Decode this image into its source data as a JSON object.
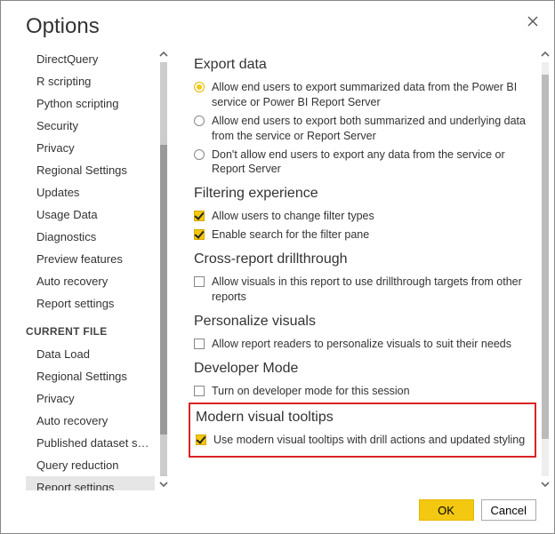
{
  "dialog": {
    "title": "Options"
  },
  "sidebar": {
    "global_items": [
      "DirectQuery",
      "R scripting",
      "Python scripting",
      "Security",
      "Privacy",
      "Regional Settings",
      "Updates",
      "Usage Data",
      "Diagnostics",
      "Preview features",
      "Auto recovery",
      "Report settings"
    ],
    "cf_heading": "CURRENT FILE",
    "cf_items": [
      "Data Load",
      "Regional Settings",
      "Privacy",
      "Auto recovery",
      "Published dataset set...",
      "Query reduction",
      "Report settings"
    ],
    "cf_selected_index": 6
  },
  "content": {
    "export": {
      "title": "Export data",
      "opt0": "Allow end users to export summarized data from the Power BI service or Power BI Report Server",
      "opt1": "Allow end users to export both summarized and underlying data from the service or Report Server",
      "opt2": "Don't allow end users to export any data from the service or Report Server",
      "selected": 0
    },
    "filtering": {
      "title": "Filtering experience",
      "chk0": {
        "label": "Allow users to change filter types",
        "checked": true
      },
      "chk1": {
        "label": "Enable search for the filter pane",
        "checked": true
      }
    },
    "crossreport": {
      "title": "Cross-report drillthrough",
      "chk0": {
        "label": "Allow visuals in this report to use drillthrough targets from other reports",
        "checked": false
      }
    },
    "personalize": {
      "title": "Personalize visuals",
      "chk0": {
        "label": "Allow report readers to personalize visuals to suit their needs",
        "checked": false
      }
    },
    "devmode": {
      "title": "Developer Mode",
      "chk0": {
        "label": "Turn on developer mode for this session",
        "checked": false
      }
    },
    "tooltips": {
      "title": "Modern visual tooltips",
      "chk0": {
        "label": "Use modern visual tooltips with drill actions and updated styling",
        "checked": true
      }
    }
  },
  "buttons": {
    "ok": "OK",
    "cancel": "Cancel"
  }
}
